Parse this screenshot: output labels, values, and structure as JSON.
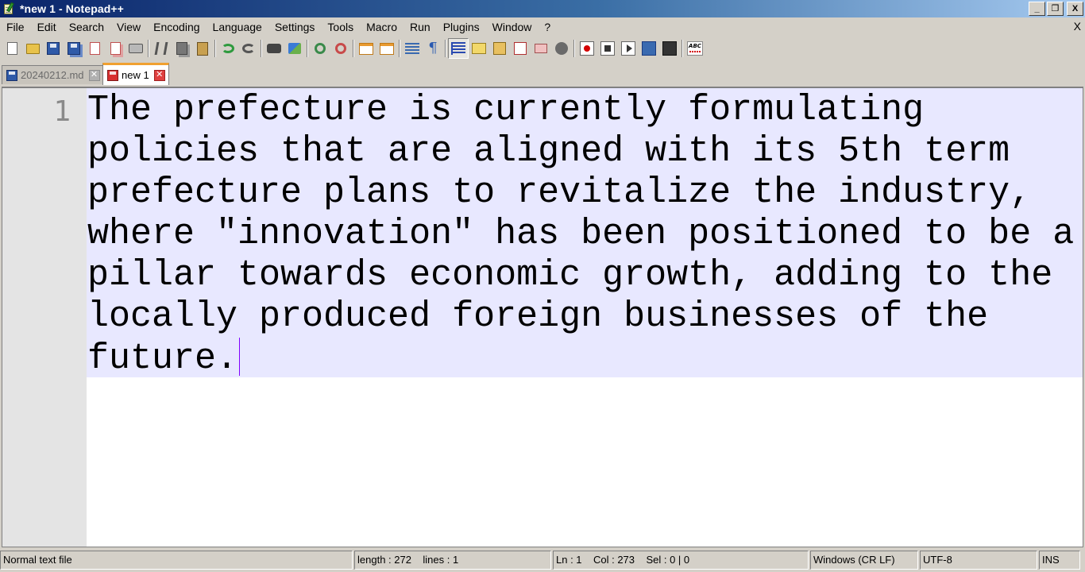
{
  "window": {
    "title": "*new 1 - Notepad++",
    "controls": {
      "minimize": "_",
      "restore": "❐",
      "close": "X"
    }
  },
  "menu": {
    "items": [
      "File",
      "Edit",
      "Search",
      "View",
      "Encoding",
      "Language",
      "Settings",
      "Tools",
      "Macro",
      "Run",
      "Plugins",
      "Window",
      "?"
    ],
    "close_doc": "X"
  },
  "toolbar": {
    "icons": [
      "new-file-icon",
      "open-file-icon",
      "save-icon",
      "save-all-icon",
      "close-icon",
      "close-all-icon",
      "print-icon",
      "cut-icon",
      "copy-icon",
      "paste-icon",
      "undo-icon",
      "redo-icon",
      "find-icon",
      "replace-icon",
      "zoom-in-icon",
      "zoom-out-icon",
      "sync-vertical-icon",
      "sync-horizontal-icon",
      "word-wrap-icon",
      "show-all-chars-icon",
      "indent-guide-icon",
      "document-map-icon",
      "function-list-icon",
      "folder-workspace-icon",
      "monitoring-icon",
      "record-macro-icon",
      "stop-macro-icon",
      "playback-macro-icon",
      "run-macro-multiple-icon",
      "save-macro-icon",
      "spell-check-icon"
    ],
    "spell_label": "ABC"
  },
  "tabs": [
    {
      "label": "20240212.md",
      "active": false,
      "saved": true
    },
    {
      "label": "new 1",
      "active": true,
      "saved": false
    }
  ],
  "editor": {
    "line_number": "1",
    "text": "The prefecture is currently formulating policies that are aligned with its 5th term prefecture plans to revitalize the industry, where \"innovation\" has been positioned to be a pillar towards economic growth, adding to the locally produced foreign businesses of the future."
  },
  "status": {
    "file_type": "Normal text file",
    "length_lines": "length : 272    lines : 1",
    "position": "Ln : 1    Col : 273    Sel : 0 | 0",
    "eol": "Windows (CR LF)",
    "encoding": "UTF-8",
    "mode": "INS"
  },
  "colors": {
    "title_gradient_start": "#0a246a",
    "title_gradient_end": "#a6caf0",
    "current_line_highlight": "#e8e8ff",
    "caret": "#8000ff",
    "active_tab_accent": "#f0a030"
  }
}
